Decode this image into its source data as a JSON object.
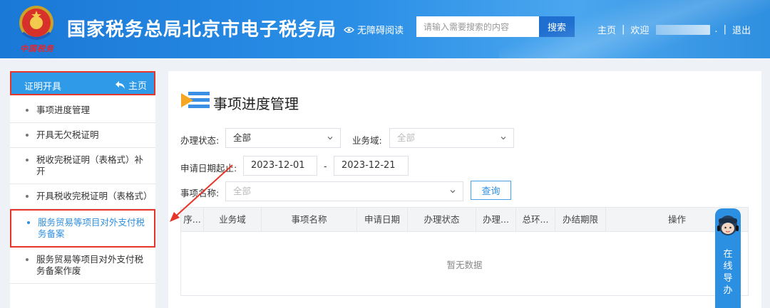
{
  "header": {
    "emblem_text": "中国税务",
    "title": "国家税务总局北京市电子税务局",
    "accessibility": "无障碍阅读",
    "search_placeholder": "请输入需要搜索的内容",
    "search_button": "搜索",
    "nav_home": "主页",
    "welcome": "欢迎",
    "welcome_suffix": ".",
    "logout": "退出"
  },
  "sidebar": {
    "header_title": "证明开具",
    "home_link": "主页",
    "items": [
      {
        "label": "事项进度管理"
      },
      {
        "label": "开具无欠税证明"
      },
      {
        "label": "税收完税证明（表格式）补开"
      },
      {
        "label": "开具税收完税证明（表格式）"
      },
      {
        "label": "服务贸易等项目对外支付税务备案"
      },
      {
        "label": "服务贸易等项目对外支付税务备案作废"
      }
    ]
  },
  "main": {
    "page_title": "事项进度管理",
    "filters": {
      "status_label": "办理状态:",
      "status_value": "全部",
      "domain_label": "业务域:",
      "domain_value": "全部",
      "date_label": "申请日期起止:",
      "date_from": "2023-12-01",
      "date_sep": "-",
      "date_to": "2023-12-21",
      "item_label": "事项名称:",
      "item_value": "全部",
      "query_button": "查询"
    },
    "table": {
      "columns": [
        "序...",
        "业务域",
        "事项名称",
        "申请日期",
        "办理状态",
        "办理...",
        "总环...",
        "办结期限",
        "操作"
      ],
      "empty_text": "暂无数据"
    }
  },
  "guide": {
    "label": "在线导办"
  },
  "colors": {
    "header_blue": "#1a78d6",
    "accent_blue": "#2f8fe0",
    "highlight_red": "#e8352a"
  }
}
